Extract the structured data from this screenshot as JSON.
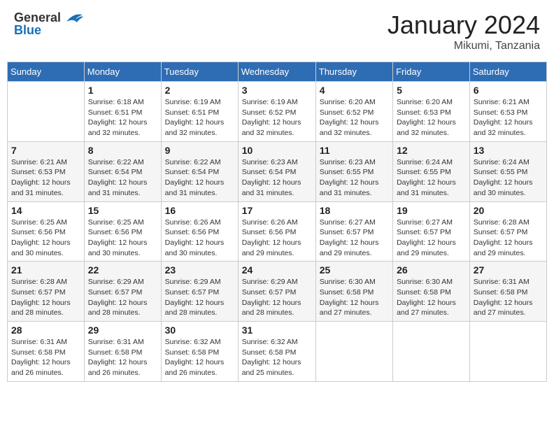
{
  "header": {
    "logo_general": "General",
    "logo_blue": "Blue",
    "month_title": "January 2024",
    "location": "Mikumi, Tanzania"
  },
  "days_of_week": [
    "Sunday",
    "Monday",
    "Tuesday",
    "Wednesday",
    "Thursday",
    "Friday",
    "Saturday"
  ],
  "weeks": [
    [
      {
        "day": "",
        "info": ""
      },
      {
        "day": "1",
        "info": "Sunrise: 6:18 AM\nSunset: 6:51 PM\nDaylight: 12 hours\nand 32 minutes."
      },
      {
        "day": "2",
        "info": "Sunrise: 6:19 AM\nSunset: 6:51 PM\nDaylight: 12 hours\nand 32 minutes."
      },
      {
        "day": "3",
        "info": "Sunrise: 6:19 AM\nSunset: 6:52 PM\nDaylight: 12 hours\nand 32 minutes."
      },
      {
        "day": "4",
        "info": "Sunrise: 6:20 AM\nSunset: 6:52 PM\nDaylight: 12 hours\nand 32 minutes."
      },
      {
        "day": "5",
        "info": "Sunrise: 6:20 AM\nSunset: 6:53 PM\nDaylight: 12 hours\nand 32 minutes."
      },
      {
        "day": "6",
        "info": "Sunrise: 6:21 AM\nSunset: 6:53 PM\nDaylight: 12 hours\nand 32 minutes."
      }
    ],
    [
      {
        "day": "7",
        "info": "Sunrise: 6:21 AM\nSunset: 6:53 PM\nDaylight: 12 hours\nand 31 minutes."
      },
      {
        "day": "8",
        "info": "Sunrise: 6:22 AM\nSunset: 6:54 PM\nDaylight: 12 hours\nand 31 minutes."
      },
      {
        "day": "9",
        "info": "Sunrise: 6:22 AM\nSunset: 6:54 PM\nDaylight: 12 hours\nand 31 minutes."
      },
      {
        "day": "10",
        "info": "Sunrise: 6:23 AM\nSunset: 6:54 PM\nDaylight: 12 hours\nand 31 minutes."
      },
      {
        "day": "11",
        "info": "Sunrise: 6:23 AM\nSunset: 6:55 PM\nDaylight: 12 hours\nand 31 minutes."
      },
      {
        "day": "12",
        "info": "Sunrise: 6:24 AM\nSunset: 6:55 PM\nDaylight: 12 hours\nand 31 minutes."
      },
      {
        "day": "13",
        "info": "Sunrise: 6:24 AM\nSunset: 6:55 PM\nDaylight: 12 hours\nand 30 minutes."
      }
    ],
    [
      {
        "day": "14",
        "info": "Sunrise: 6:25 AM\nSunset: 6:56 PM\nDaylight: 12 hours\nand 30 minutes."
      },
      {
        "day": "15",
        "info": "Sunrise: 6:25 AM\nSunset: 6:56 PM\nDaylight: 12 hours\nand 30 minutes."
      },
      {
        "day": "16",
        "info": "Sunrise: 6:26 AM\nSunset: 6:56 PM\nDaylight: 12 hours\nand 30 minutes."
      },
      {
        "day": "17",
        "info": "Sunrise: 6:26 AM\nSunset: 6:56 PM\nDaylight: 12 hours\nand 29 minutes."
      },
      {
        "day": "18",
        "info": "Sunrise: 6:27 AM\nSunset: 6:57 PM\nDaylight: 12 hours\nand 29 minutes."
      },
      {
        "day": "19",
        "info": "Sunrise: 6:27 AM\nSunset: 6:57 PM\nDaylight: 12 hours\nand 29 minutes."
      },
      {
        "day": "20",
        "info": "Sunrise: 6:28 AM\nSunset: 6:57 PM\nDaylight: 12 hours\nand 29 minutes."
      }
    ],
    [
      {
        "day": "21",
        "info": "Sunrise: 6:28 AM\nSunset: 6:57 PM\nDaylight: 12 hours\nand 28 minutes."
      },
      {
        "day": "22",
        "info": "Sunrise: 6:29 AM\nSunset: 6:57 PM\nDaylight: 12 hours\nand 28 minutes."
      },
      {
        "day": "23",
        "info": "Sunrise: 6:29 AM\nSunset: 6:57 PM\nDaylight: 12 hours\nand 28 minutes."
      },
      {
        "day": "24",
        "info": "Sunrise: 6:29 AM\nSunset: 6:57 PM\nDaylight: 12 hours\nand 28 minutes."
      },
      {
        "day": "25",
        "info": "Sunrise: 6:30 AM\nSunset: 6:58 PM\nDaylight: 12 hours\nand 27 minutes."
      },
      {
        "day": "26",
        "info": "Sunrise: 6:30 AM\nSunset: 6:58 PM\nDaylight: 12 hours\nand 27 minutes."
      },
      {
        "day": "27",
        "info": "Sunrise: 6:31 AM\nSunset: 6:58 PM\nDaylight: 12 hours\nand 27 minutes."
      }
    ],
    [
      {
        "day": "28",
        "info": "Sunrise: 6:31 AM\nSunset: 6:58 PM\nDaylight: 12 hours\nand 26 minutes."
      },
      {
        "day": "29",
        "info": "Sunrise: 6:31 AM\nSunset: 6:58 PM\nDaylight: 12 hours\nand 26 minutes."
      },
      {
        "day": "30",
        "info": "Sunrise: 6:32 AM\nSunset: 6:58 PM\nDaylight: 12 hours\nand 26 minutes."
      },
      {
        "day": "31",
        "info": "Sunrise: 6:32 AM\nSunset: 6:58 PM\nDaylight: 12 hours\nand 25 minutes."
      },
      {
        "day": "",
        "info": ""
      },
      {
        "day": "",
        "info": ""
      },
      {
        "day": "",
        "info": ""
      }
    ]
  ]
}
